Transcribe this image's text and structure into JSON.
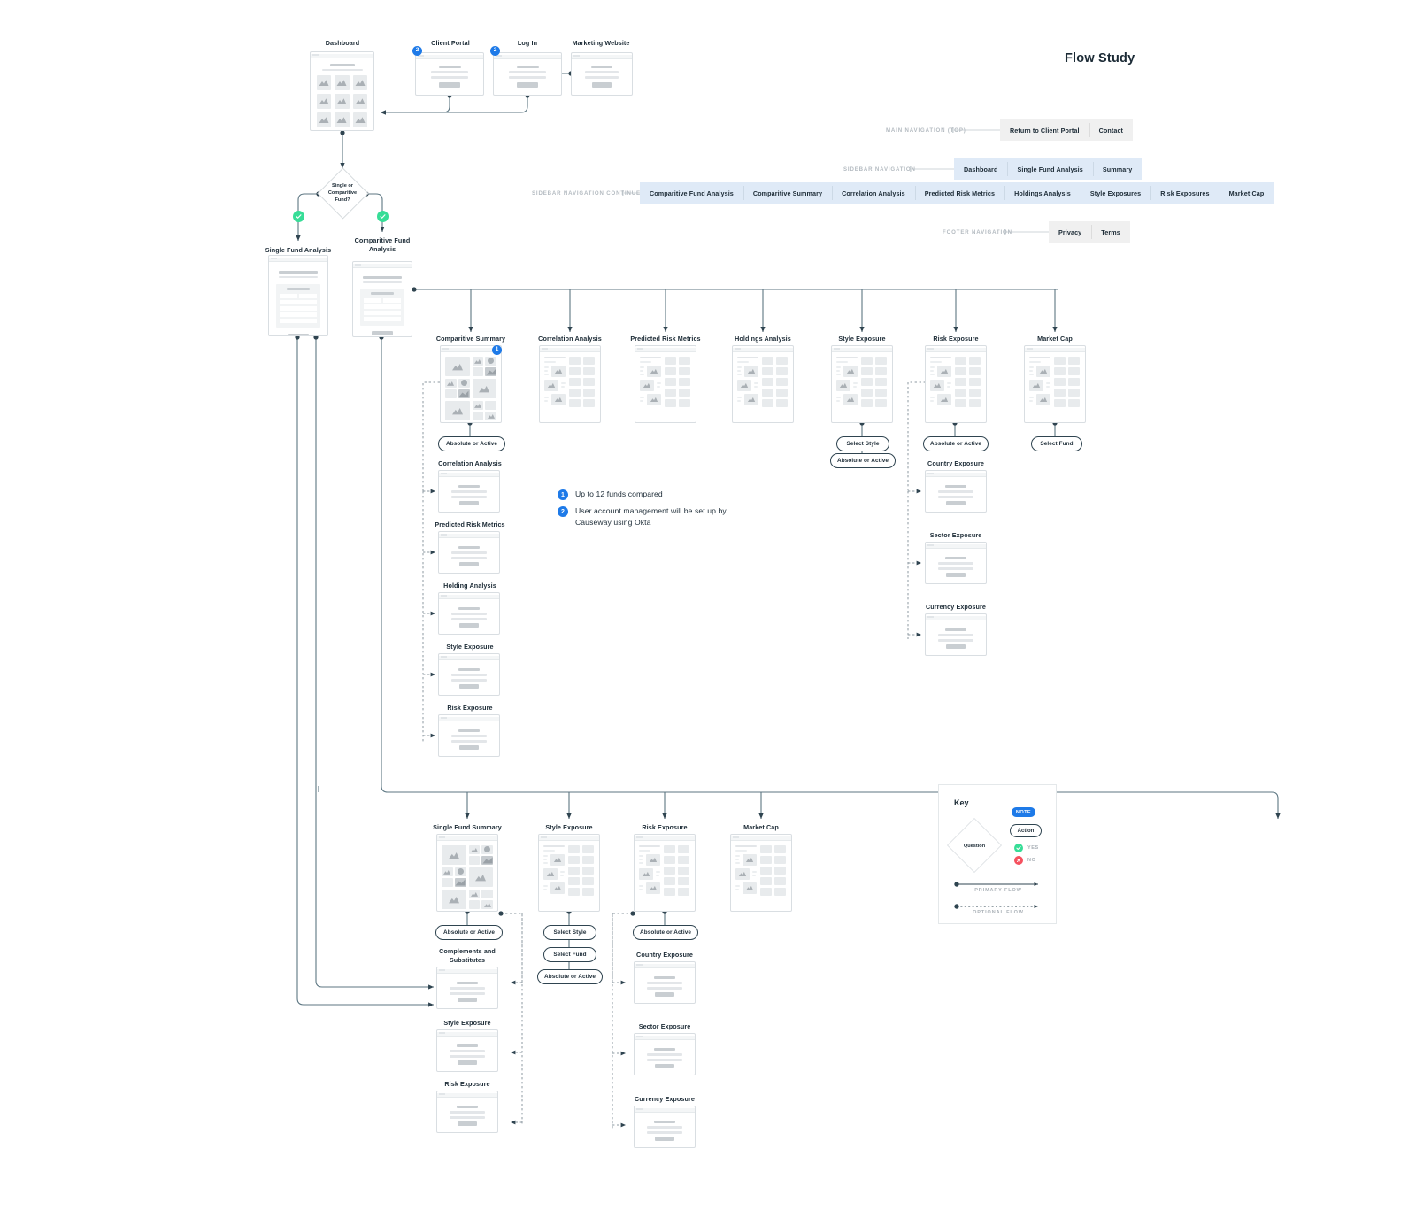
{
  "page": {
    "title": "Flow Study"
  },
  "navigation": {
    "main": {
      "caption": "MAIN NAVIGATION (TOP)",
      "items": [
        "Return to Client Portal",
        "Contact"
      ]
    },
    "sidebar": {
      "caption": "SIDEBAR NAVIGATION",
      "items": [
        "Dashboard",
        "Single Fund Analysis",
        "Summary"
      ]
    },
    "sidebar_continued": {
      "caption": "SIDEBAR NAVIGATION CONTINUED",
      "items": [
        "Comparitive Fund Analysis",
        "Comparitive Summary",
        "Correlation Analysis",
        "Predicted Risk Metrics",
        "Holdings Analysis",
        "Style Exposures",
        "Risk Exposures",
        "Market Cap"
      ]
    },
    "footer": {
      "caption": "FOOTER NAVIGATION",
      "items": [
        "Privacy",
        "Terms"
      ]
    }
  },
  "top_flow": {
    "dashboard": "Dashboard",
    "client_portal": "Client Portal",
    "login": "Log In",
    "marketing": "Marketing Website"
  },
  "decision": {
    "label": "Single or\nComparitive\nFund?",
    "line1": "Single or",
    "line2": "Comparitive",
    "line3": "Fund?"
  },
  "branches": {
    "single": "Single Fund Analysis",
    "comparitive_l1": "Comparitive Fund",
    "comparitive_l2": "Analysis"
  },
  "comparitive_row": [
    {
      "label": "Comparitive Summary"
    },
    {
      "label": "Correlation Analysis"
    },
    {
      "label": "Predicted Risk Metrics"
    },
    {
      "label": "Holdings Analysis"
    },
    {
      "label": "Style Exposure"
    },
    {
      "label": "Risk Exposure"
    },
    {
      "label": "Market Cap"
    }
  ],
  "comparitive_actions": {
    "summary": "Absolute or Active",
    "style_select": "Select Style",
    "style_absolute": "Absolute or Active",
    "risk_absolute": "Absolute or Active",
    "market_select": "Select Fund"
  },
  "comparitive_subscreens": [
    {
      "label": "Correlation Analysis"
    },
    {
      "label": "Predicted Risk Metrics"
    },
    {
      "label": "Holding Analysis"
    },
    {
      "label": "Style Exposure"
    },
    {
      "label": "Risk Exposure"
    }
  ],
  "comparitive_risk_subscreens": [
    {
      "label": "Country Exposure"
    },
    {
      "label": "Sector Exposure"
    },
    {
      "label": "Currency Exposure"
    }
  ],
  "notes": [
    {
      "num": "1",
      "text": "Up to 12 funds compared"
    },
    {
      "num": "2",
      "text": "User account management will be set up by Causeway using Okta"
    }
  ],
  "markers": {
    "summary_badge": "1",
    "client_portal_badge": "2",
    "login_badge": "2"
  },
  "single_row": [
    {
      "label": "Single Fund Summary"
    },
    {
      "label": "Style Exposure"
    },
    {
      "label": "Risk Exposure"
    },
    {
      "label": "Market Cap"
    }
  ],
  "single_actions": {
    "summary": "Absolute or Active",
    "style_select_style": "Select Style",
    "style_select_fund": "Select Fund",
    "style_absolute": "Absolute or Active",
    "risk_absolute": "Absolute or Active"
  },
  "single_subscreens": [
    {
      "line1": "Complements and",
      "line2": "Substitutes"
    },
    {
      "line1": "Style Exposure",
      "line2": ""
    },
    {
      "line1": "Risk Exposure",
      "line2": ""
    }
  ],
  "single_risk_subscreens": [
    {
      "label": "Country Exposure"
    },
    {
      "label": "Sector Exposure"
    },
    {
      "label": "Currency Exposure"
    }
  ],
  "key": {
    "title": "Key",
    "note_pill": "NOTE",
    "action_pill": "Action",
    "question": "Question",
    "yes": "YES",
    "no": "NO",
    "primary_flow": "PRIMARY FLOW",
    "optional_flow": "OPTIONAL FLOW"
  },
  "colors": {
    "accent_blue": "#1e7ae8",
    "yes_green": "#37dd97",
    "no_red": "#f5515f",
    "wire": "#5c7682",
    "nav_blue": "#dfeaf7",
    "nav_grey": "#f0f0f0",
    "ink": "#1c2b36"
  }
}
